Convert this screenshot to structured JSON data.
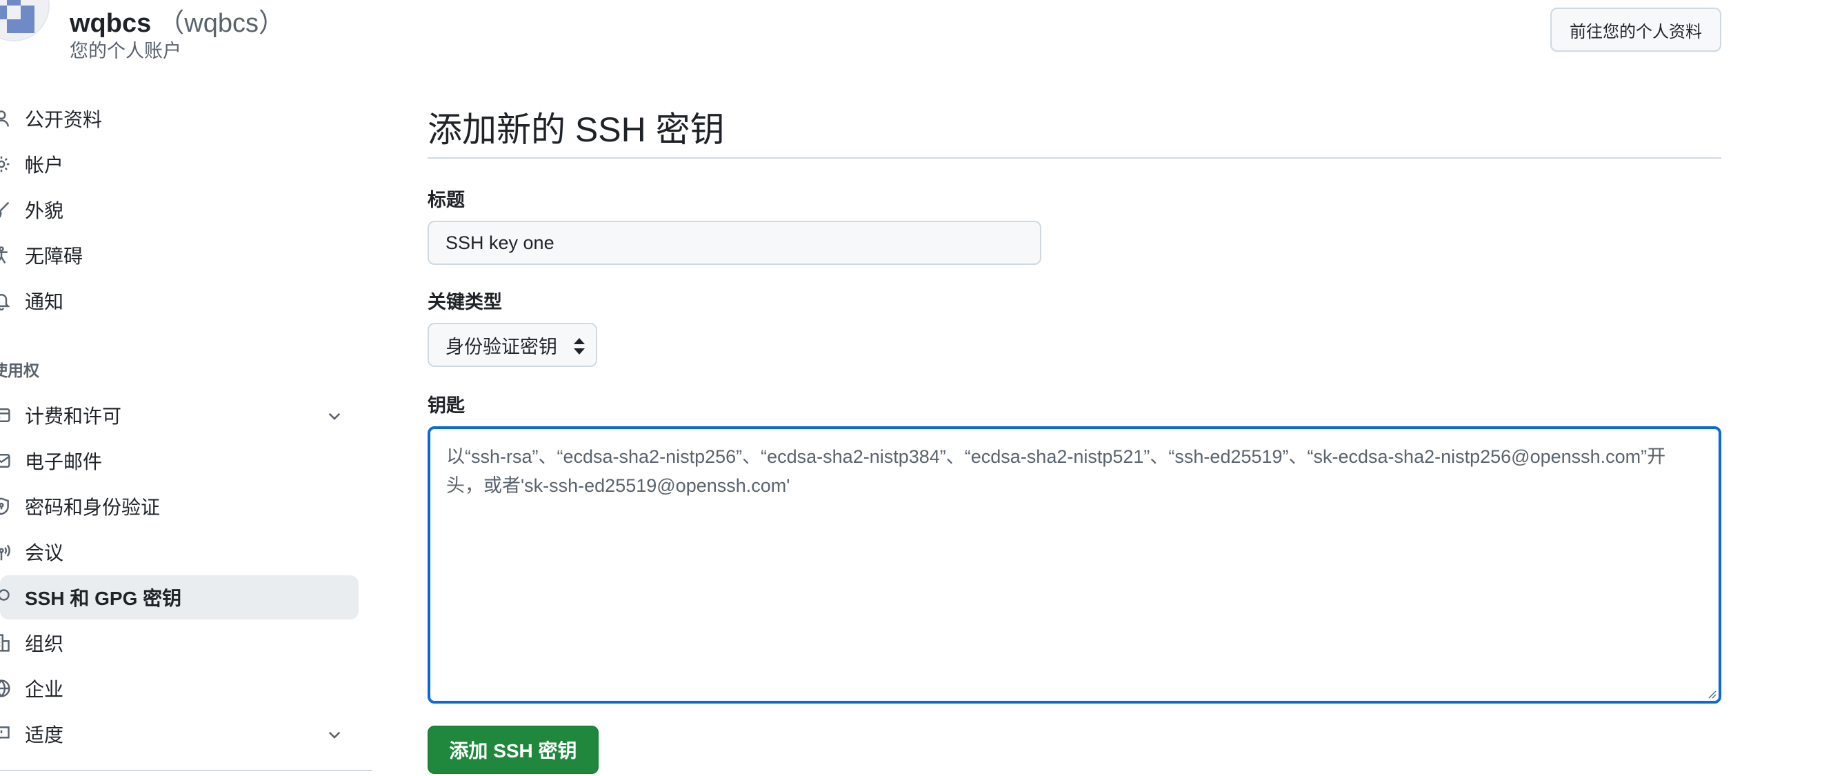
{
  "header": {
    "display_name": "wqbcs",
    "login": "（wqbcs）",
    "subtitle": "您的个人账户",
    "profile_button": "前往您的个人资料"
  },
  "sidebar": {
    "items": [
      {
        "label": "公开资料",
        "icon": "person-icon"
      },
      {
        "label": "帐户",
        "icon": "gear-icon"
      },
      {
        "label": "外貌",
        "icon": "paintbrush-icon"
      },
      {
        "label": "无障碍",
        "icon": "accessibility-icon"
      },
      {
        "label": "通知",
        "icon": "bell-icon"
      }
    ],
    "section_heading": "使用权",
    "access_items": [
      {
        "label": "计费和许可",
        "icon": "credit-card-icon",
        "expandable": true
      },
      {
        "label": "电子邮件",
        "icon": "mail-icon"
      },
      {
        "label": "密码和身份验证",
        "icon": "shield-lock-icon"
      },
      {
        "label": "会议",
        "icon": "broadcast-icon"
      },
      {
        "label": "SSH 和 GPG 密钥",
        "icon": "key-icon",
        "active": true
      },
      {
        "label": "组织",
        "icon": "organization-icon"
      },
      {
        "label": "企业",
        "icon": "globe-icon"
      },
      {
        "label": "适度",
        "icon": "report-icon",
        "expandable": true
      }
    ]
  },
  "main": {
    "title": "添加新的 SSH 密钥",
    "title_label": "标题",
    "title_value": "SSH key one",
    "key_type_label": "关键类型",
    "key_type_value": "身份验证密钥",
    "key_label": "钥匙",
    "key_placeholder": "以“ssh-rsa”、“ecdsa-sha2-nistp256”、“ecdsa-sha2-nistp384”、“ecdsa-sha2-nistp521”、“ssh-ed25519”、“sk-ecdsa-sha2-nistp256@openssh.com”开头，或者'sk-ssh-ed25519@openssh.com'",
    "submit_button": "添加 SSH 密钥"
  },
  "colors": {
    "accent_blue": "#0969da",
    "primary_green": "#1f883d",
    "border": "#d1d9e0",
    "muted_text": "#59636e"
  }
}
